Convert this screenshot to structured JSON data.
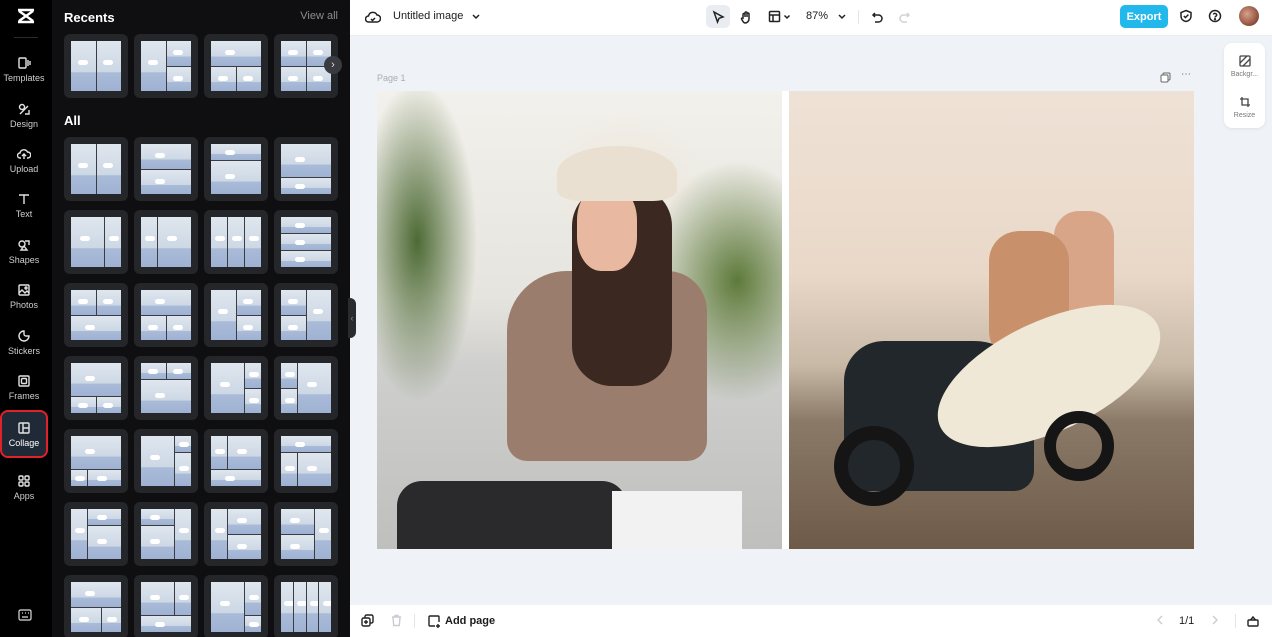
{
  "app": {
    "logo": "capcut-logo"
  },
  "sidebar": {
    "items": [
      {
        "label": "Templates",
        "icon": "templates-icon"
      },
      {
        "label": "Design",
        "icon": "design-icon"
      },
      {
        "label": "Upload",
        "icon": "upload-icon"
      },
      {
        "label": "Text",
        "icon": "text-icon"
      },
      {
        "label": "Shapes",
        "icon": "shapes-icon"
      },
      {
        "label": "Photos",
        "icon": "photos-icon"
      },
      {
        "label": "Stickers",
        "icon": "stickers-icon"
      },
      {
        "label": "Frames",
        "icon": "frames-icon"
      },
      {
        "label": "Collage",
        "icon": "collage-icon",
        "active": true
      },
      {
        "label": "Apps",
        "icon": "apps-icon"
      }
    ],
    "bottom_icon": "keyboard-shortcuts-icon"
  },
  "panel": {
    "recents_title": "Recents",
    "view_all": "View all",
    "all_title": "All",
    "recents": [
      "2-vertical",
      "1-left-2-right",
      "1-top-2-bottom",
      "2x2-grid"
    ],
    "layouts": [
      "2-vertical",
      "2-horizontal",
      "small-top-large-bottom",
      "large-top-small-bottom",
      "wide-left-narrow-right",
      "narrow-left-wide-right",
      "3-vertical",
      "3-horizontal",
      "2-top-1-bottom",
      "1-top-2-bottom",
      "1-left-2-right",
      "2-left-1-right",
      "1-top-2-bottom-small",
      "2-top-1-bottom-large",
      "1-left-2-right-tall",
      "2-left-1-right-tall",
      "1-top-2-bottom-uneven",
      "1-left-2-right-uneven",
      "2-top-left-1-bottom",
      "1-top-2-bottom-mixed",
      "left-col-right-2",
      "left-2-right-col",
      "left-col-right-2-stack",
      "left-2-stack-right-col",
      "1-top-2-bottom-b",
      "2-left-1-right-b",
      "1-left-2-right-c",
      "4-vertical"
    ]
  },
  "topbar": {
    "cloud_icon": "cloud-saved-icon",
    "title": "Untitled image",
    "zoom": "87%",
    "export": "Export"
  },
  "canvas": {
    "page_label": "Page 1",
    "photos": [
      {
        "name": "woman-in-hat-photo",
        "alt": "Woman in hat by a road"
      },
      {
        "name": "couple-on-scooter-photo",
        "alt": "Couple riding scooter with surfboard on beach"
      }
    ]
  },
  "float_panel": {
    "background": "Backgr...",
    "resize": "Resize"
  },
  "bottombar": {
    "add_page": "Add page",
    "page_counter": "1/1"
  }
}
